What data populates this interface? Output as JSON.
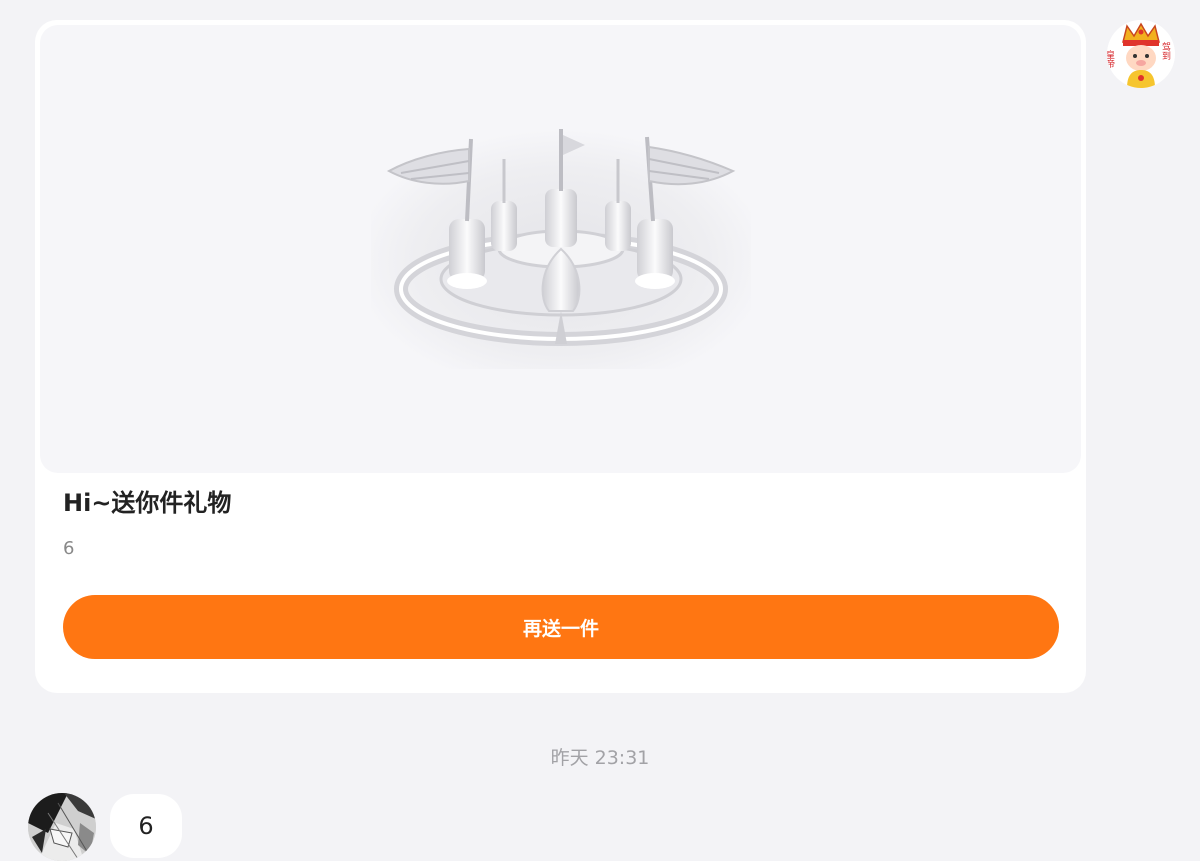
{
  "gift_card": {
    "title": "Hi~送你件礼物",
    "subtext": "6",
    "button_label": "再送一件",
    "button_color": "#ff7612"
  },
  "my_avatar": {
    "badge_left": "皇帝",
    "badge_right": "驾到"
  },
  "chat": {
    "timestamp": "昨天 23:31",
    "message_text": "6"
  },
  "icons": {
    "gift_image": "castle-gift-icon",
    "my_avatar": "emperor-avatar",
    "their_avatar": "manga-avatar"
  }
}
